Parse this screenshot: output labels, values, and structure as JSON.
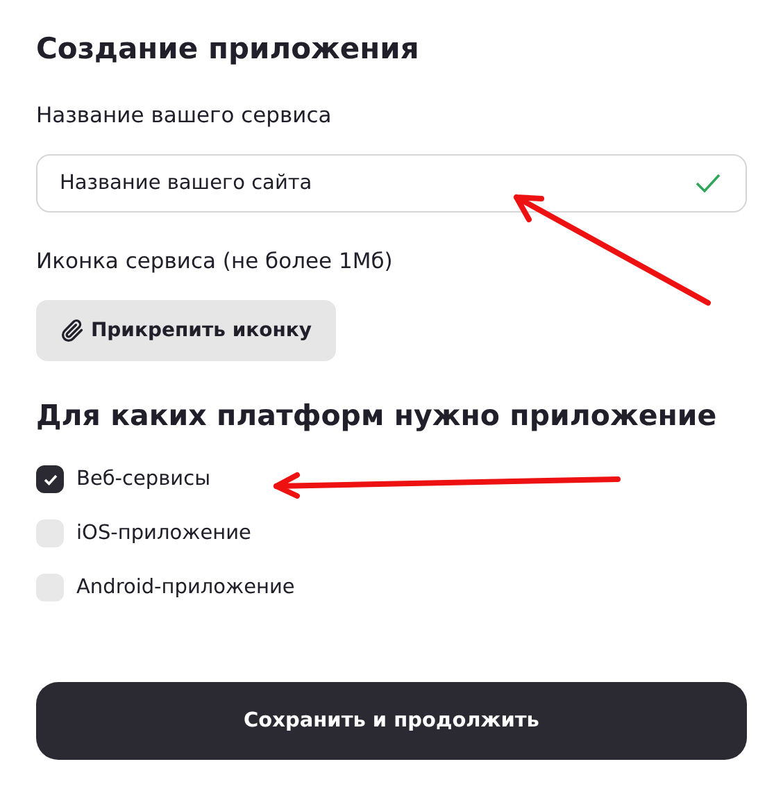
{
  "title": "Создание приложения",
  "service_name": {
    "label": "Название вашего сервиса",
    "value": "Название вашего сайта",
    "valid": true
  },
  "icon_upload": {
    "label": "Иконка сервиса (не более 1Мб)",
    "button": "Прикрепить иконку"
  },
  "platforms": {
    "title": "Для каких платформ нужно приложение",
    "options": [
      {
        "label": "Веб-сервисы",
        "checked": true
      },
      {
        "label": "iOS-приложение",
        "checked": false
      },
      {
        "label": "Android-приложение",
        "checked": false
      }
    ]
  },
  "submit": "Сохранить и продолжить"
}
